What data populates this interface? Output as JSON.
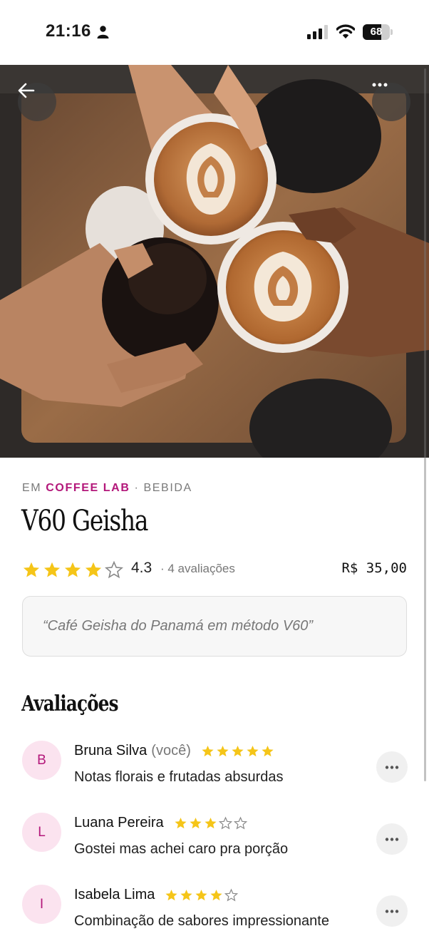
{
  "status_bar": {
    "time": "21:16",
    "battery": "68",
    "battery_level": 0.68
  },
  "hero": {
    "back_icon": "arrow-left-icon",
    "more_icon": "ellipsis-icon",
    "image_subject": "coffee-cups-toast-photo"
  },
  "product": {
    "breadcrumb_prefix": "EM",
    "place": "COFFEE LAB",
    "separator": "·",
    "category": "BEBIDA",
    "name": "V60 Geisha",
    "rating": "4.3",
    "rating_stars": 4,
    "rating_count": "· 4 avaliações",
    "price": "R$ 35,00",
    "description": "“Café Geisha do Panamá em método V60”"
  },
  "reviews_section": {
    "title": "Avaliações",
    "items": [
      {
        "initial": "B",
        "name": "Bruna Silva",
        "you_label": "(você)",
        "stars": 5,
        "text": "Notas florais e frutadas absurdas"
      },
      {
        "initial": "L",
        "name": "Luana Pereira",
        "you_label": "",
        "stars": 3,
        "text": "Gostei mas achei caro pra porção"
      },
      {
        "initial": "I",
        "name": "Isabela Lima",
        "you_label": "",
        "stars": 4,
        "text": "Combinação de sabores impressionante"
      }
    ]
  },
  "colors": {
    "accent": "#b3177a",
    "star": "#f5c518",
    "avatar_bg": "#fbe3ef"
  }
}
